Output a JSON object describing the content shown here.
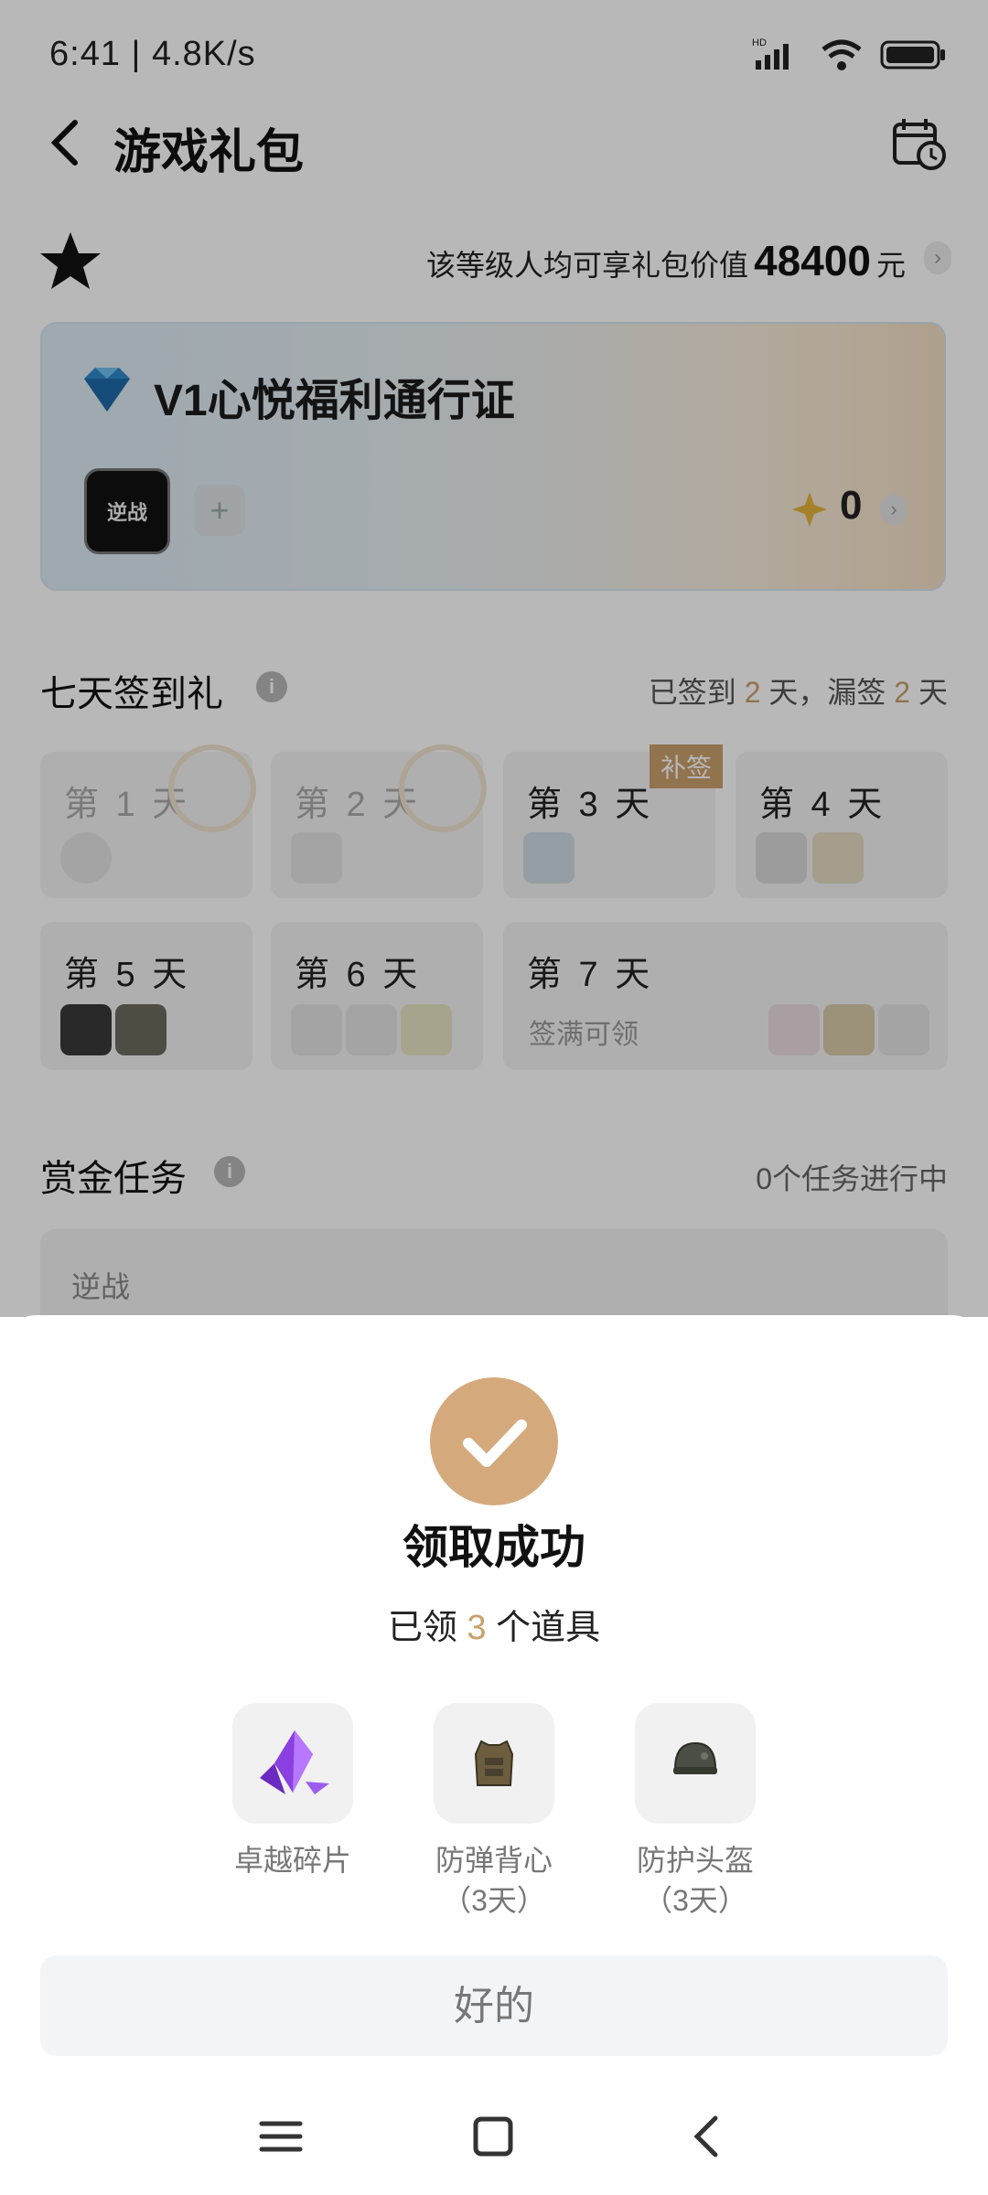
{
  "status_bar": {
    "time": "6:41 | 4.8K/s",
    "hd_label": "HD"
  },
  "header": {
    "title": "游戏礼包"
  },
  "value_row": {
    "prefix": "该等级人均可享礼包价值",
    "amount": "48400",
    "unit": "元"
  },
  "pass_card": {
    "title": "V1心悦福利通行证",
    "game_icon_text": "逆战",
    "add_symbol": "+",
    "points": "0"
  },
  "seven_day": {
    "title": "七天签到礼",
    "status": {
      "signed_prefix": "已签到",
      "signed_count": "2",
      "mid": "天，漏签",
      "missed_count": "2",
      "suffix": "天"
    },
    "days": [
      {
        "label": "第 1 天",
        "signed": true
      },
      {
        "label": "第 2 天",
        "signed": true
      },
      {
        "label": "第 3 天",
        "badge": "补签"
      },
      {
        "label": "第 4 天"
      },
      {
        "label": "第 5 天"
      },
      {
        "label": "第 6 天"
      },
      {
        "label": "第 7 天",
        "sub": "签满可领"
      }
    ]
  },
  "bounty": {
    "title": "赏金任务",
    "task_count": "0个任务进行中",
    "game_name": "逆战"
  },
  "dialog": {
    "title": "领取成功",
    "sub_prefix": "已领",
    "count": "3",
    "sub_suffix": "个道具",
    "items": [
      {
        "name": "卓越碎片",
        "icon": "crystal-shard"
      },
      {
        "name": "防弹背心",
        "duration": "（3天）",
        "icon": "bulletproof-vest"
      },
      {
        "name": "防护头盔",
        "duration": "（3天）",
        "icon": "helmet"
      }
    ],
    "ok_label": "好的"
  },
  "colors": {
    "accent_gold": "#c8a06b",
    "success_circle": "#d4aa7d"
  }
}
